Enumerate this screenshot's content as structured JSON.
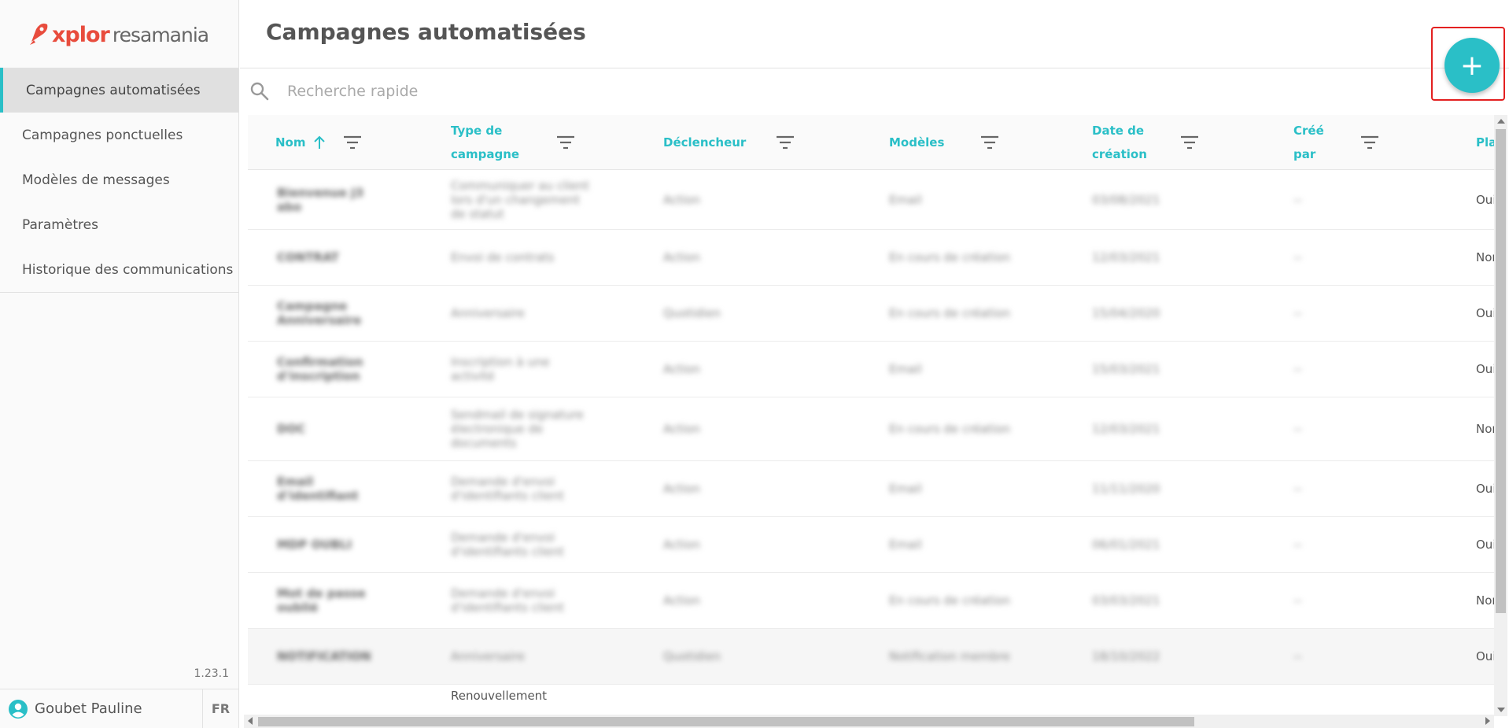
{
  "sidebar": {
    "logo": {
      "brand_a": "xplor",
      "brand_b": "resamania"
    },
    "items": [
      {
        "label": "Campagnes automatisées",
        "active": true
      },
      {
        "label": "Campagnes ponctuelles"
      },
      {
        "label": "Modèles de messages"
      },
      {
        "label": "Paramètres"
      },
      {
        "label": "Historique des communications"
      }
    ],
    "version": "1.23.1",
    "user": {
      "name": "Goubet Pauline",
      "lang": "FR"
    }
  },
  "main": {
    "title": "Campagnes automatisées",
    "search": {
      "placeholder": "Recherche rapide"
    },
    "fab": {
      "label": "+"
    }
  },
  "table": {
    "headers": [
      {
        "line1": "Nom",
        "line2": ""
      },
      {
        "line1": "Type de",
        "line2": "campagne"
      },
      {
        "line1": "Déclencheur",
        "line2": ""
      },
      {
        "line1": "Modèles",
        "line2": ""
      },
      {
        "line1": "Date de",
        "line2": "création"
      },
      {
        "line1": "Créé",
        "line2": "par"
      },
      {
        "line1": "Pla",
        "line2": ""
      }
    ],
    "rows": [
      {
        "cells": [
          "Bienvenue J3 abo",
          "Communiquer au client lors d'un changement de statut",
          "Action",
          "Email",
          "03/08/2021",
          "--",
          "Oui"
        ]
      },
      {
        "cells": [
          "CONTRAT",
          "Envoi de contrats",
          "Action",
          "En cours de création",
          "12/03/2021",
          "--",
          "Non"
        ]
      },
      {
        "cells": [
          "Campagne Anniversaire",
          "Anniversaire",
          "Quotidien",
          "En cours de création",
          "15/04/2020",
          "--",
          "Oui"
        ]
      },
      {
        "cells": [
          "Confirmation d'inscription",
          "Inscription à une activité",
          "Action",
          "Email",
          "15/03/2021",
          "--",
          "Oui"
        ]
      },
      {
        "cells": [
          "DOC",
          "Sendmail de signature électronique de documents",
          "Action",
          "En cours de création",
          "12/03/2021",
          "--",
          "Non"
        ]
      },
      {
        "cells": [
          "Email d'identifiant",
          "Demande d'envoi d'identifiants client",
          "Action",
          "Email",
          "11/11/2020",
          "--",
          "Oui"
        ]
      },
      {
        "cells": [
          "MDP OUBLI",
          "Demande d'envoi d'identifiants client",
          "Action",
          "Email",
          "06/01/2021",
          "--",
          "Oui"
        ]
      },
      {
        "cells": [
          "Mot de passe oublié",
          "Demande d'envoi d'identifiants client",
          "Action",
          "En cours de création",
          "03/03/2021",
          "--",
          "Non"
        ]
      },
      {
        "cells": [
          "NOTIFICATION",
          "Anniversaire",
          "Quotidien",
          "Notification membre",
          "18/10/2022",
          "--",
          "Oui"
        ]
      },
      {
        "cells": [
          "",
          "Renouvellement",
          "",
          "",
          "",
          "",
          ""
        ]
      }
    ]
  },
  "colors": {
    "accent": "#2abfc7",
    "brand": "#e84c3d",
    "highlight_border": "#e32020"
  }
}
